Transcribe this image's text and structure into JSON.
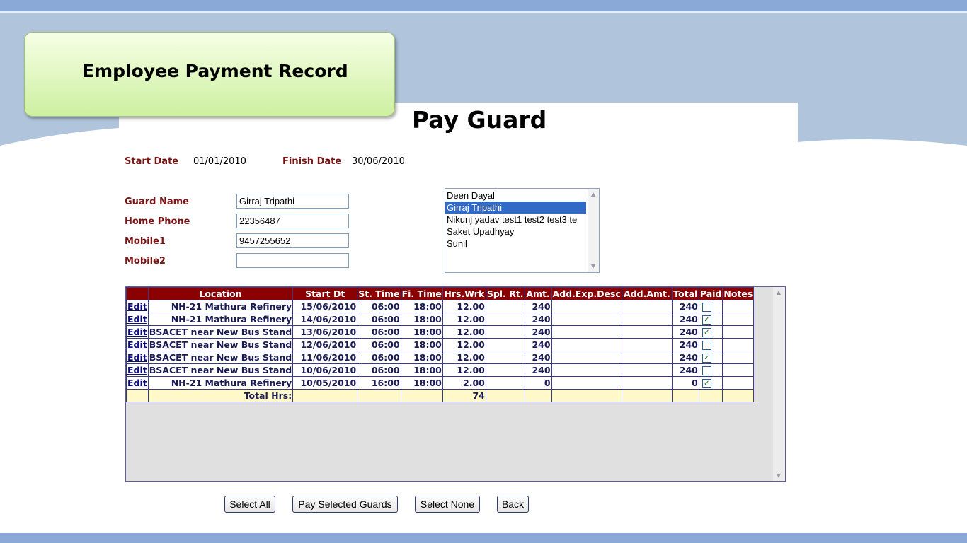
{
  "slide_title": "Employee Payment Record",
  "page_heading": "Pay Guard",
  "dates": {
    "start_label": "Start Date",
    "start_value": "01/01/2010",
    "finish_label": "Finish Date",
    "finish_value": "30/06/2010"
  },
  "guard": {
    "name_label": "Guard Name",
    "name_value": "Girraj Tripathi",
    "home_phone_label": "Home Phone",
    "home_phone_value": "22356487",
    "mobile1_label": "Mobile1",
    "mobile1_value": "9457255652",
    "mobile2_label": "Mobile2",
    "mobile2_value": ""
  },
  "guard_list": {
    "items": [
      "Deen Dayal",
      "Girraj Tripathi",
      "Nikunj yadav test1 test2 test3 te",
      "Saket Upadhyay",
      "Sunil"
    ],
    "selected_index": 1
  },
  "table": {
    "headers": [
      "",
      "Location",
      "Start Dt",
      "St. Time",
      "Fi. Time",
      "Hrs.Wrk",
      "Spl. Rt.",
      "Amt.",
      "Add.Exp.Desc",
      "Add.Amt.",
      "Total",
      "Paid",
      "Notes"
    ],
    "edit_label": "Edit",
    "rows": [
      {
        "location": "NH-21 Mathura Refinery",
        "start_dt": "15/06/2010",
        "st_time": "06:00",
        "fi_time": "18:00",
        "hrs": "12.00",
        "spl_rt": "",
        "amt": "240",
        "add_desc": "",
        "add_amt": "",
        "total": "240",
        "paid": false,
        "notes": ""
      },
      {
        "location": "NH-21 Mathura Refinery",
        "start_dt": "14/06/2010",
        "st_time": "06:00",
        "fi_time": "18:00",
        "hrs": "12.00",
        "spl_rt": "",
        "amt": "240",
        "add_desc": "",
        "add_amt": "",
        "total": "240",
        "paid": true,
        "notes": ""
      },
      {
        "location": "BSACET near New Bus Stand",
        "start_dt": "13/06/2010",
        "st_time": "06:00",
        "fi_time": "18:00",
        "hrs": "12.00",
        "spl_rt": "",
        "amt": "240",
        "add_desc": "",
        "add_amt": "",
        "total": "240",
        "paid": true,
        "notes": ""
      },
      {
        "location": "BSACET near New Bus Stand",
        "start_dt": "12/06/2010",
        "st_time": "06:00",
        "fi_time": "18:00",
        "hrs": "12.00",
        "spl_rt": "",
        "amt": "240",
        "add_desc": "",
        "add_amt": "",
        "total": "240",
        "paid": false,
        "notes": ""
      },
      {
        "location": "BSACET near New Bus Stand",
        "start_dt": "11/06/2010",
        "st_time": "06:00",
        "fi_time": "18:00",
        "hrs": "12.00",
        "spl_rt": "",
        "amt": "240",
        "add_desc": "",
        "add_amt": "",
        "total": "240",
        "paid": true,
        "notes": ""
      },
      {
        "location": "BSACET near New Bus Stand",
        "start_dt": "10/06/2010",
        "st_time": "06:00",
        "fi_time": "18:00",
        "hrs": "12.00",
        "spl_rt": "",
        "amt": "240",
        "add_desc": "",
        "add_amt": "",
        "total": "240",
        "paid": false,
        "notes": ""
      },
      {
        "location": "NH-21 Mathura Refinery",
        "start_dt": "10/05/2010",
        "st_time": "16:00",
        "fi_time": "18:00",
        "hrs": "2.00",
        "spl_rt": "",
        "amt": "0",
        "add_desc": "",
        "add_amt": "",
        "total": "0",
        "paid": true,
        "notes": ""
      }
    ],
    "total_label": "Total Hrs:",
    "total_hours": "74"
  },
  "buttons": {
    "select_all": "Select All",
    "pay_selected": "Pay Selected Guards",
    "select_none": "Select None",
    "back": "Back"
  },
  "colors": {
    "header_bg": "#8b0000",
    "label_color": "#7a1515",
    "selected_item": "#3169c6",
    "title_box": "#cdf0a0",
    "band": "#b0c4dc"
  }
}
